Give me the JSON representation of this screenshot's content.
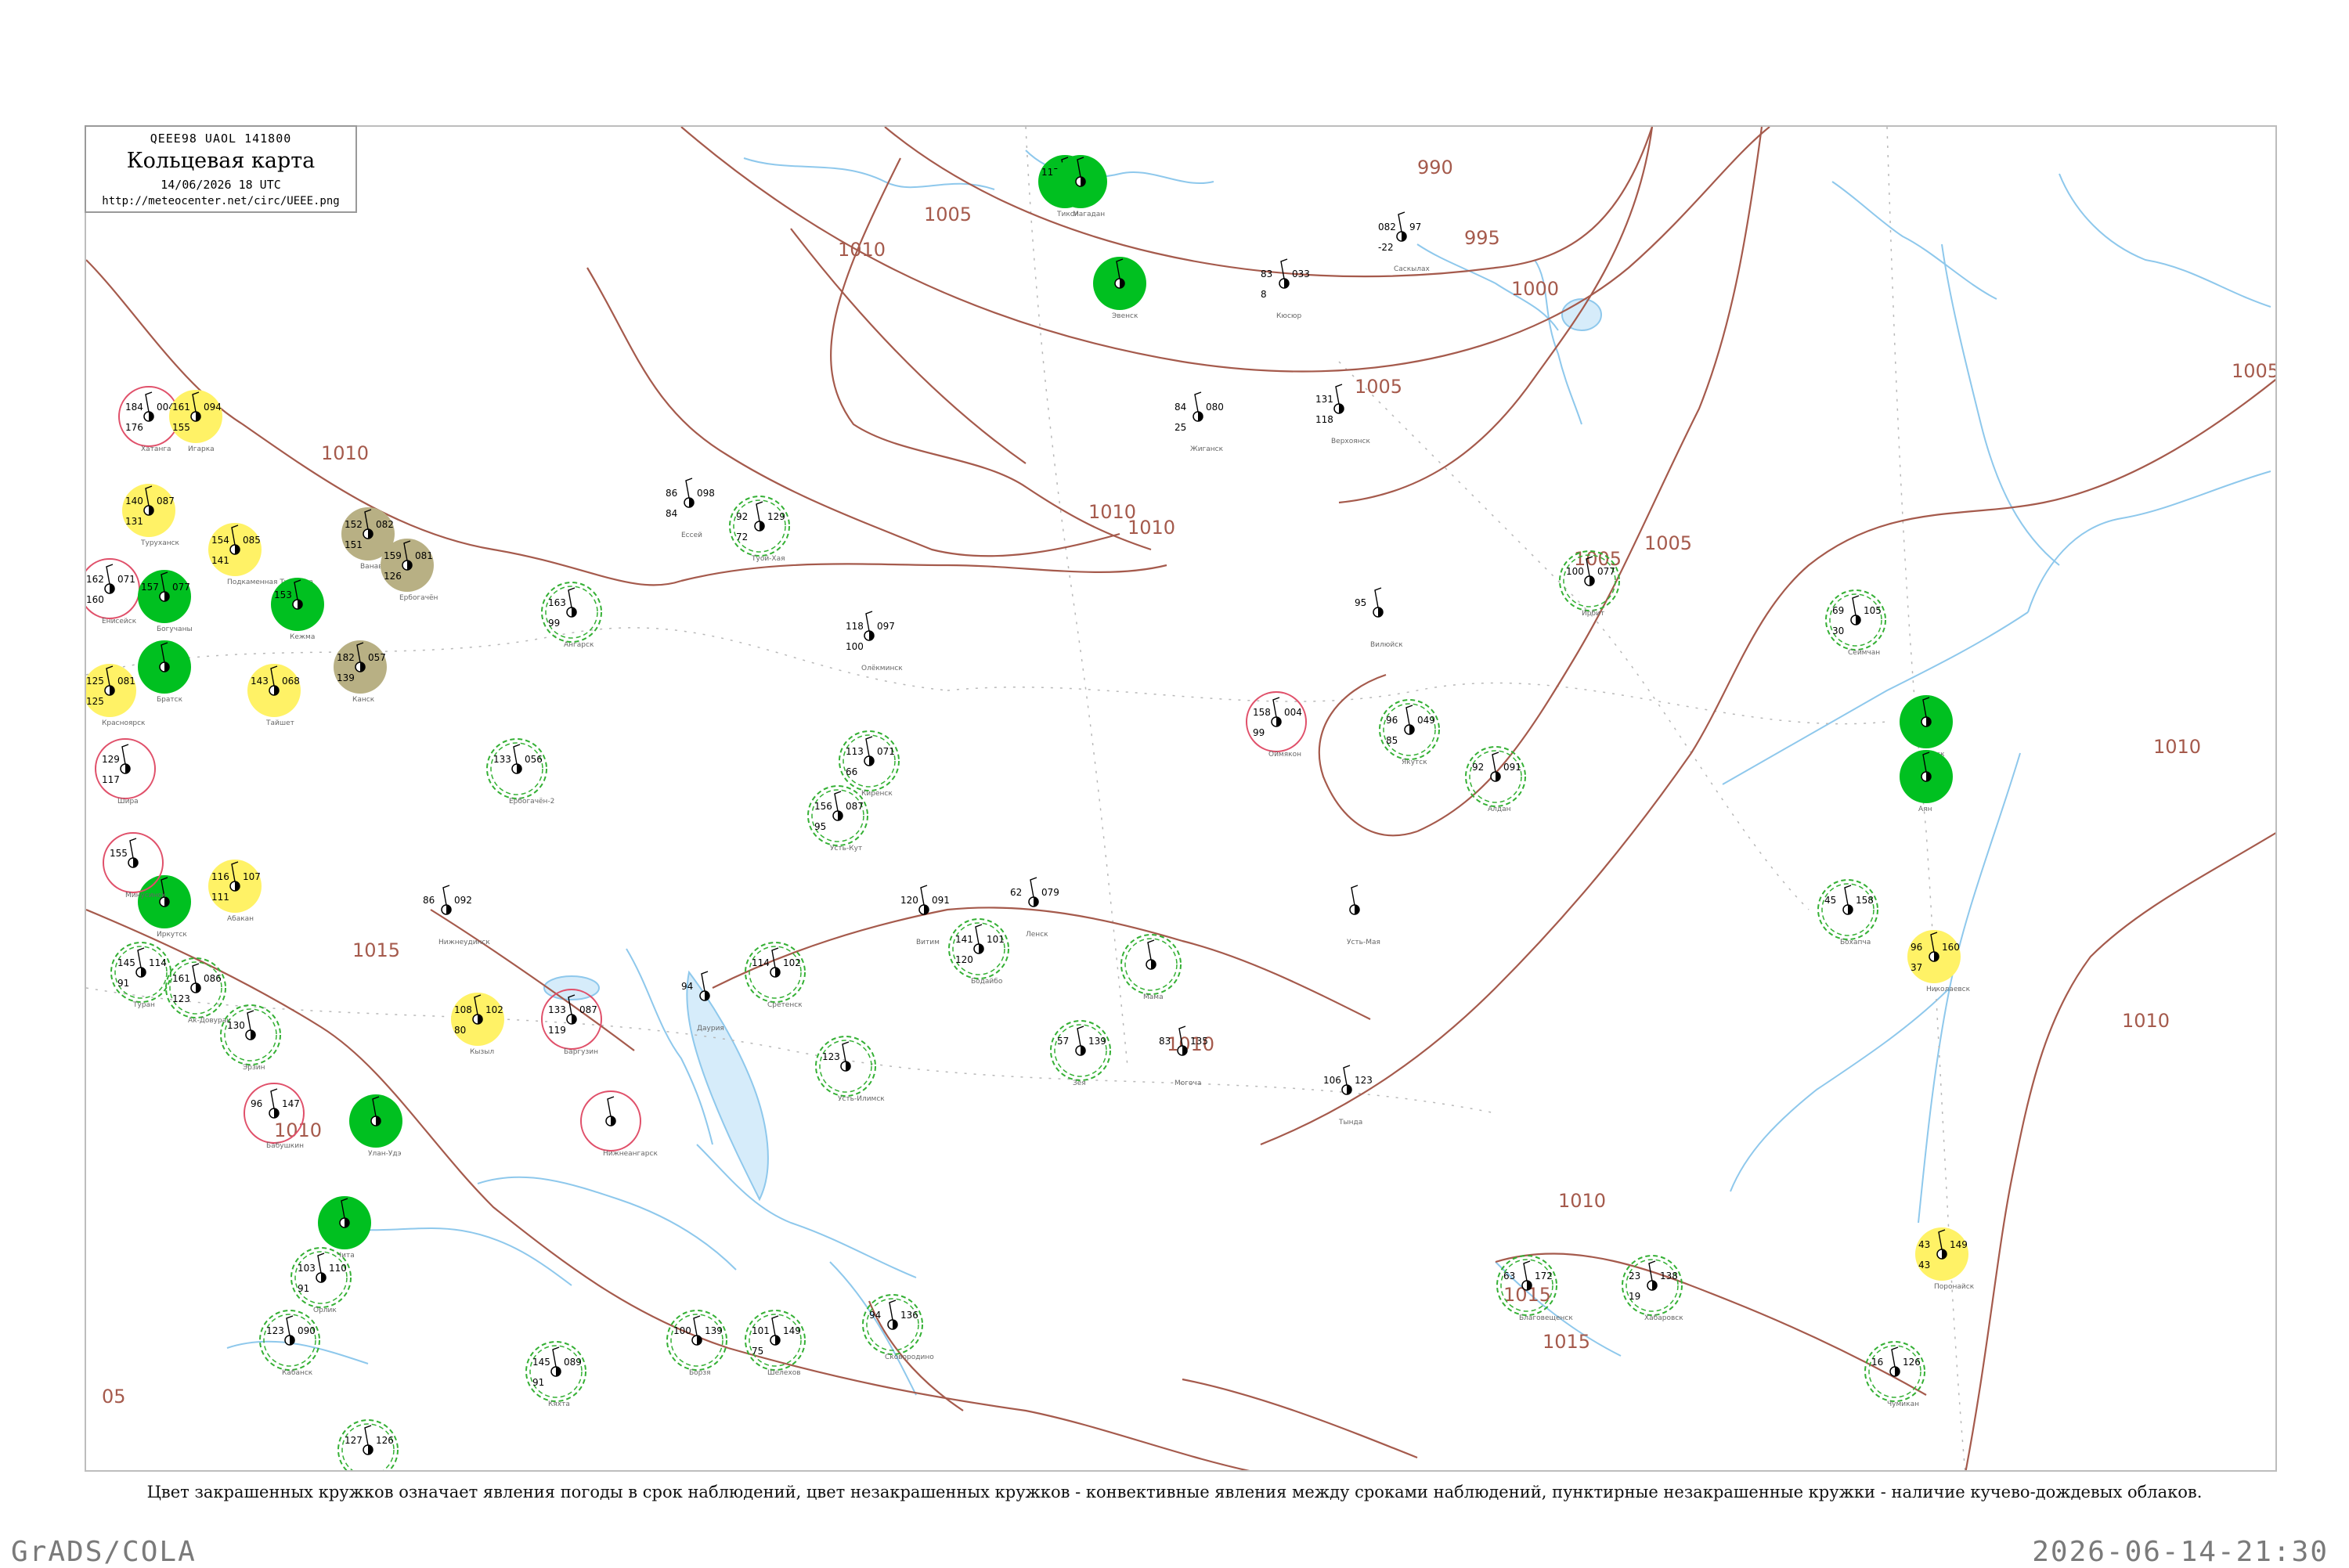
{
  "header": {
    "code": "QEEE98  UAOL  141800",
    "title": "Кольцевая карта",
    "date": "14/06/2026 18 UTC",
    "url": "http://meteocenter.net/circ/UEEE.png"
  },
  "legend": "Цвет закрашенных кружков означает явления погоды в срок наблюдений, цвет незакрашенных кружков - конвективные явления между сроками наблюдений, пунктирные незакрашенные кружки - наличие кучево-дождевых облаков.",
  "footer": {
    "left": "GrADS/COLA",
    "right": "2026-06-14-21:30"
  },
  "colors": {
    "isobar": "#a55a4c",
    "water": "#8ec8ec",
    "rain_fill": "#00c020",
    "showers_fill": "#fff266",
    "haze_fill": "#b8b084",
    "cb_ring": "#34b034",
    "thunder_ring": "#e0506a"
  },
  "isobar_labels": [
    {
      "text": "990"
    },
    {
      "text": "995"
    },
    {
      "text": "1000"
    },
    {
      "text": "1005"
    },
    {
      "text": "1005"
    },
    {
      "text": "1005"
    },
    {
      "text": "1005"
    },
    {
      "text": "1005"
    },
    {
      "text": "1010"
    },
    {
      "text": "1010"
    },
    {
      "text": "1010"
    },
    {
      "text": "1010"
    },
    {
      "text": "1010"
    },
    {
      "text": "1010"
    },
    {
      "text": "1010"
    },
    {
      "text": "1010"
    },
    {
      "text": "1010"
    },
    {
      "text": "1015"
    },
    {
      "text": "1015"
    },
    {
      "text": "1015"
    },
    {
      "text": "05"
    }
  ],
  "stations": [
    {
      "name": "Тикси",
      "a": "117",
      "b": "97",
      "c": "",
      "fill": "rain"
    },
    {
      "name": "Кюсюр",
      "a": "83",
      "b": "033",
      "c": "8",
      "fill": "none"
    },
    {
      "name": "Саскылах",
      "a": "082",
      "b": "97",
      "c": "-22",
      "fill": "none"
    },
    {
      "name": "Хатанга",
      "a": "184",
      "b": "004",
      "c": "176",
      "fill": "thunder"
    },
    {
      "name": "Игарка",
      "a": "161",
      "b": "094",
      "c": "155",
      "fill": "showers"
    },
    {
      "name": "Туруханск",
      "a": "140",
      "b": "087",
      "c": "131",
      "fill": "showers"
    },
    {
      "name": "Ванавара",
      "a": "152",
      "b": "082",
      "c": "151",
      "fill": "haze"
    },
    {
      "name": "Ербогачён",
      "a": "159",
      "b": "081",
      "c": "126",
      "fill": "haze"
    },
    {
      "name": "Подкаменная Тунгуска",
      "a": "154",
      "b": "085",
      "c": "141",
      "fill": "showers"
    },
    {
      "name": "Енисейск",
      "a": "162",
      "b": "071",
      "c": "160",
      "fill": "thunder"
    },
    {
      "name": "Богучаны",
      "a": "157",
      "b": "077",
      "c": "",
      "fill": "rain"
    },
    {
      "name": "Кежма",
      "a": "153",
      "b": "",
      "c": "",
      "fill": "rain"
    },
    {
      "name": "Канск",
      "a": "182",
      "b": "057",
      "c": "139",
      "fill": "haze"
    },
    {
      "name": "Красноярск",
      "a": "125",
      "b": "081",
      "c": "125",
      "fill": "showers"
    },
    {
      "name": "Тайшет",
      "a": "143",
      "b": "068",
      "c": "",
      "fill": "showers"
    },
    {
      "name": "Абакан",
      "a": "116",
      "b": "107",
      "c": "111",
      "fill": "showers"
    },
    {
      "name": "Кызыл",
      "a": "108",
      "b": "102",
      "c": "80",
      "fill": "showers"
    },
    {
      "name": "Братск",
      "a": "",
      "b": "",
      "c": "",
      "fill": "rain"
    },
    {
      "name": "Иркутск",
      "a": "",
      "b": "",
      "c": "",
      "fill": "rain"
    },
    {
      "name": "Улан-Удэ",
      "a": "",
      "b": "",
      "c": "",
      "fill": "rain"
    },
    {
      "name": "Чита",
      "a": "",
      "b": "",
      "c": "",
      "fill": "rain"
    },
    {
      "name": "Оймякон",
      "a": "158",
      "b": "004",
      "c": "99",
      "fill": "thunder"
    },
    {
      "name": "Охотск",
      "a": "",
      "b": "",
      "c": "",
      "fill": "rain"
    },
    {
      "name": "Аян",
      "a": "",
      "b": "",
      "c": "",
      "fill": "rain"
    },
    {
      "name": "Николаевск",
      "a": "96",
      "b": "160",
      "c": "37",
      "fill": "showers"
    },
    {
      "name": "Поронайск",
      "a": "43",
      "b": "149",
      "c": "43",
      "fill": "showers"
    },
    {
      "name": "Олёкминск",
      "a": "118",
      "b": "097",
      "c": "100",
      "fill": "none"
    },
    {
      "name": "Якутск",
      "a": "96",
      "b": "049",
      "c": "85",
      "fill": "cb"
    },
    {
      "name": "Алдан",
      "a": "92",
      "b": "091",
      "c": "",
      "fill": "cb"
    },
    {
      "name": "Усть-Мая",
      "a": "",
      "b": "",
      "c": "",
      "fill": "none"
    },
    {
      "name": "Зея",
      "a": "57",
      "b": "139",
      "c": "",
      "fill": "cb"
    },
    {
      "name": "Благовещенск",
      "a": "63",
      "b": "172",
      "c": "",
      "fill": "cb"
    },
    {
      "name": "Хабаровск",
      "a": "23",
      "b": "138",
      "c": "19",
      "fill": "cb"
    },
    {
      "name": "Ленск",
      "a": "62",
      "b": "079",
      "c": "",
      "fill": "none"
    },
    {
      "name": "Витим",
      "a": "120",
      "b": "091",
      "c": "",
      "fill": "none"
    },
    {
      "name": "Бодайбо",
      "a": "141",
      "b": "101",
      "c": "120",
      "fill": "cb"
    },
    {
      "name": "Киренск",
      "a": "113",
      "b": "071",
      "c": "66",
      "fill": "cb"
    },
    {
      "name": "Усть-Кут",
      "a": "156",
      "b": "087",
      "c": "95",
      "fill": "cb"
    },
    {
      "name": "Нижнеудинск",
      "a": "86",
      "b": "092",
      "c": "",
      "fill": "none"
    },
    {
      "name": "Могоча",
      "a": "83",
      "b": "135",
      "c": "",
      "fill": "none"
    },
    {
      "name": "Тында",
      "a": "106",
      "b": "123",
      "c": "",
      "fill": "none"
    },
    {
      "name": "Магадан",
      "a": "",
      "b": "",
      "c": "",
      "fill": "rain"
    },
    {
      "name": "Эвенск",
      "a": "",
      "b": "",
      "c": "",
      "fill": "rain"
    },
    {
      "name": "Верхоянск",
      "a": "131",
      "b": "",
      "c": "118",
      "fill": "none"
    },
    {
      "name": "Жиганск",
      "a": "84",
      "b": "080",
      "c": "25",
      "fill": "none"
    },
    {
      "name": "Вилюйск",
      "a": "95",
      "b": "",
      "c": "",
      "fill": "none"
    },
    {
      "name": "Туой-Хая",
      "a": "92",
      "b": "129",
      "c": "72",
      "fill": "cb"
    },
    {
      "name": "Ессей",
      "a": "86",
      "b": "098",
      "c": "84",
      "fill": "none"
    },
    {
      "name": "Ирбит",
      "a": "100",
      "b": "077",
      "c": "",
      "fill": "cb"
    },
    {
      "name": "Сеймчан",
      "a": "69",
      "b": "105",
      "c": "30",
      "fill": "cb"
    },
    {
      "name": "Бохапча",
      "a": "45",
      "b": "158",
      "c": "",
      "fill": "cb"
    },
    {
      "name": "Чумикан",
      "a": "16",
      "b": "126",
      "c": "",
      "fill": "cb"
    },
    {
      "name": "Сковородино",
      "a": "94",
      "b": "136",
      "c": "",
      "fill": "cb"
    },
    {
      "name": "Шелехов",
      "a": "101",
      "b": "149",
      "c": "75",
      "fill": "cb"
    },
    {
      "name": "Борзя",
      "a": "100",
      "b": "139",
      "c": "",
      "fill": "cb"
    },
    {
      "name": "Кяхта",
      "a": "145",
      "b": "089",
      "c": "91",
      "fill": "cb"
    },
    {
      "name": "Монды",
      "a": "127",
      "b": "126",
      "c": "",
      "fill": "cb"
    },
    {
      "name": "Орлик",
      "a": "103",
      "b": "110",
      "c": "91",
      "fill": "cb"
    },
    {
      "name": "Ак-Довурак",
      "a": "161",
      "b": "086",
      "c": "123",
      "fill": "cb"
    },
    {
      "name": "Эрзин",
      "a": "130",
      "b": "",
      "c": "",
      "fill": "cb"
    },
    {
      "name": "Туран",
      "a": "145",
      "b": "114",
      "c": "91",
      "fill": "cb"
    },
    {
      "name": "Минусинск",
      "a": "155",
      "b": "",
      "c": "",
      "fill": "thunder"
    },
    {
      "name": "Шира",
      "a": "129",
      "b": "",
      "c": "117",
      "fill": "thunder"
    },
    {
      "name": "Даурия",
      "a": "94",
      "b": "",
      "c": "",
      "fill": "none"
    },
    {
      "name": "Сретенск",
      "a": "114",
      "b": "102",
      "c": "",
      "fill": "cb"
    },
    {
      "name": "Баргузин",
      "a": "133",
      "b": "087",
      "c": "119",
      "fill": "thunder"
    },
    {
      "name": "Нижнеангарск",
      "a": "",
      "b": "",
      "c": "",
      "fill": "thunder"
    },
    {
      "name": "Бабушкин",
      "a": "96",
      "b": "147",
      "c": "",
      "fill": "thunder"
    },
    {
      "name": "Кабанск",
      "a": "123",
      "b": "090",
      "c": "",
      "fill": "cb"
    },
    {
      "name": "Ербогачён-2",
      "a": "133",
      "b": "056",
      "c": "",
      "fill": "cb"
    },
    {
      "name": "Ангарск",
      "a": "163",
      "b": "",
      "c": "99",
      "fill": "cb"
    },
    {
      "name": "Усть-Илимск",
      "a": "123",
      "b": "",
      "c": "",
      "fill": "cb"
    },
    {
      "name": "Мама",
      "a": "",
      "b": "",
      "c": "",
      "fill": "cb"
    }
  ]
}
